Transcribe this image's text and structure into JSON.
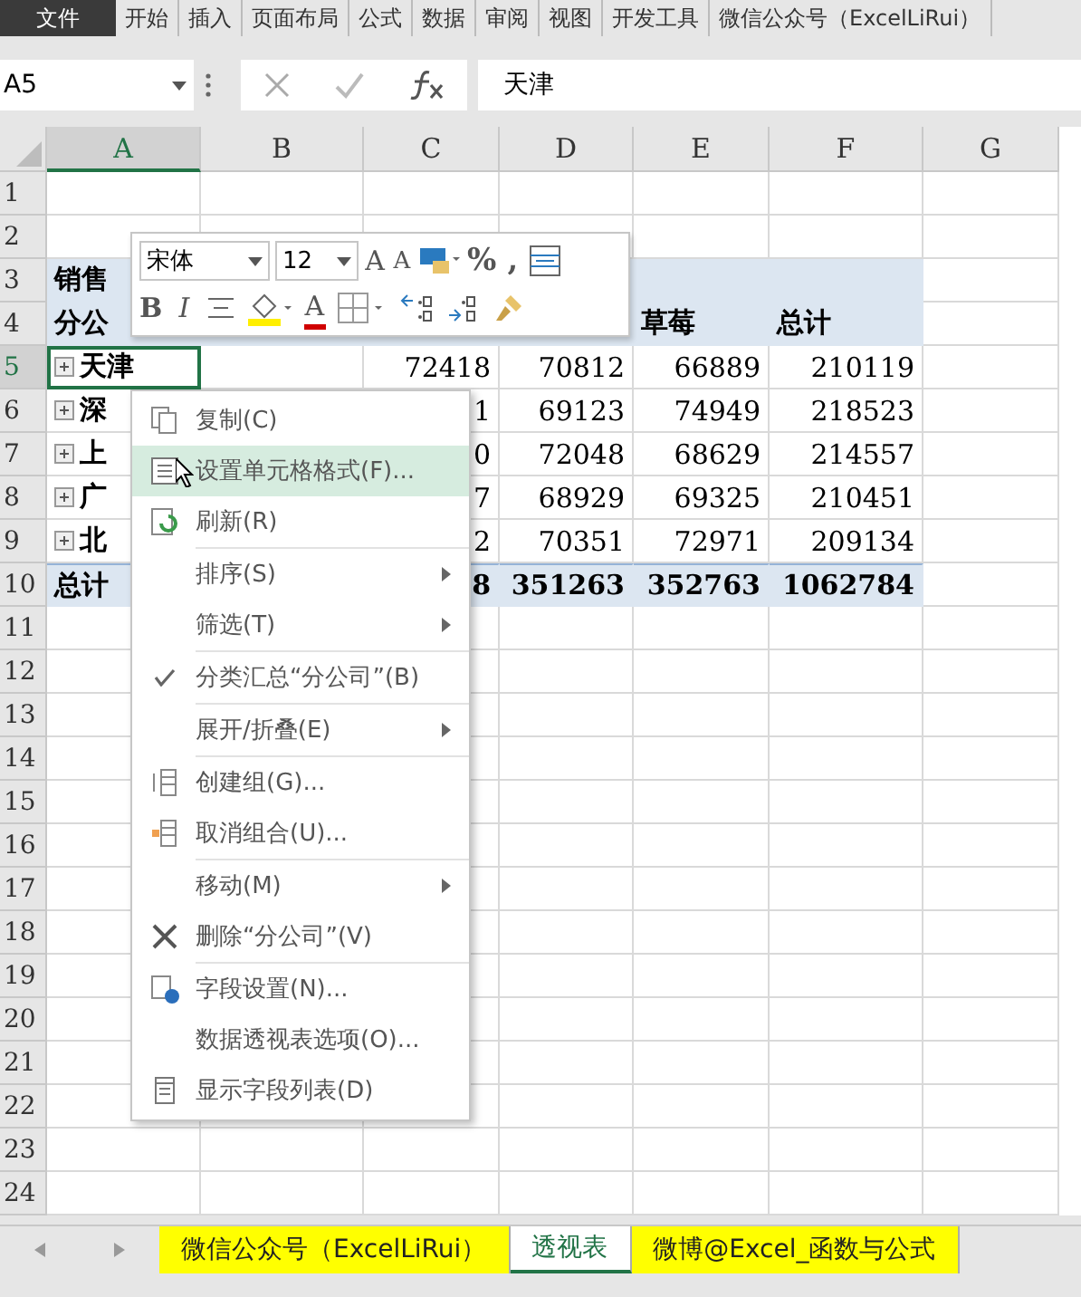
{
  "ribbon_tabs": [
    {
      "label": "文件",
      "selected": true
    },
    {
      "label": "开始",
      "selected": false
    },
    {
      "label": "插入",
      "selected": false
    },
    {
      "label": "页面布局",
      "selected": false
    },
    {
      "label": "公式",
      "selected": false
    },
    {
      "label": "数据",
      "selected": false
    },
    {
      "label": "审阅",
      "selected": false
    },
    {
      "label": "视图",
      "selected": false
    },
    {
      "label": "开发工具",
      "selected": false
    },
    {
      "label": "微信公众号（ExcelLiRui）",
      "selected": false
    }
  ],
  "formula_bar": {
    "name_box": "A5",
    "value": "天津"
  },
  "columns": [
    {
      "label": "A",
      "selected": true
    },
    {
      "label": "B",
      "selected": false
    },
    {
      "label": "C",
      "selected": false
    },
    {
      "label": "D",
      "selected": false
    },
    {
      "label": "E",
      "selected": false
    },
    {
      "label": "F",
      "selected": false
    },
    {
      "label": "G",
      "selected": false
    }
  ],
  "rows": [
    {
      "number": "1",
      "kind": "plain",
      "selected": false
    },
    {
      "number": "2",
      "kind": "plain",
      "selected": false
    },
    {
      "number": "3",
      "kind": "pivot-head",
      "selected": false,
      "col_a": "销售"
    },
    {
      "number": "4",
      "kind": "pivot-head",
      "selected": false,
      "col_a": "分公",
      "col_e": "草莓",
      "col_f": "总计"
    },
    {
      "number": "5",
      "kind": "pivot-item",
      "selected": true,
      "col_a": "天津",
      "col_c": "72418",
      "col_d": "70812",
      "col_e": "66889",
      "col_f": "210119"
    },
    {
      "number": "6",
      "kind": "pivot-item",
      "selected": false,
      "col_a": "深",
      "col_c": "1",
      "col_d": "69123",
      "col_e": "74949",
      "col_f": "218523"
    },
    {
      "number": "7",
      "kind": "pivot-item",
      "selected": false,
      "col_a": "上",
      "col_c": "0",
      "col_d": "72048",
      "col_e": "68629",
      "col_f": "214557"
    },
    {
      "number": "8",
      "kind": "pivot-item",
      "selected": false,
      "col_a": "广",
      "col_c": "7",
      "col_d": "68929",
      "col_e": "69325",
      "col_f": "210451"
    },
    {
      "number": "9",
      "kind": "pivot-item",
      "selected": false,
      "col_a": "北",
      "col_c": "2",
      "col_d": "70351",
      "col_e": "72971",
      "col_f": "209134"
    },
    {
      "number": "10",
      "kind": "pivot-total",
      "selected": false,
      "col_a": "总计",
      "col_c": "8",
      "col_d": "351263",
      "col_e": "352763",
      "col_f": "1062784"
    },
    {
      "number": "11",
      "kind": "plain",
      "selected": false
    },
    {
      "number": "12",
      "kind": "plain",
      "selected": false
    },
    {
      "number": "13",
      "kind": "plain",
      "selected": false
    },
    {
      "number": "14",
      "kind": "plain",
      "selected": false
    },
    {
      "number": "15",
      "kind": "plain",
      "selected": false
    },
    {
      "number": "16",
      "kind": "plain",
      "selected": false
    },
    {
      "number": "17",
      "kind": "plain",
      "selected": false
    },
    {
      "number": "18",
      "kind": "plain",
      "selected": false
    },
    {
      "number": "19",
      "kind": "plain",
      "selected": false
    },
    {
      "number": "20",
      "kind": "plain",
      "selected": false
    },
    {
      "number": "21",
      "kind": "plain",
      "selected": false
    },
    {
      "number": "22",
      "kind": "plain",
      "selected": false
    },
    {
      "number": "23",
      "kind": "plain",
      "selected": false
    },
    {
      "number": "24",
      "kind": "plain",
      "selected": false
    }
  ],
  "mini_toolbar": {
    "font": "宋体",
    "size": "12",
    "row1": [
      {
        "kind": "grow",
        "text": "A"
      },
      {
        "kind": "shrink",
        "text": "A"
      },
      {
        "kind": "accounting"
      },
      {
        "kind": "text",
        "text": "%"
      },
      {
        "kind": "text",
        "text": ","
      },
      {
        "kind": "wrap"
      }
    ],
    "row2": [
      {
        "kind": "bold",
        "text": "B"
      },
      {
        "kind": "italic",
        "text": "I"
      },
      {
        "kind": "align"
      },
      {
        "kind": "fill"
      },
      {
        "kind": "fontcolor",
        "text": "A"
      },
      {
        "kind": "borders"
      },
      {
        "kind": "increase-decimal"
      },
      {
        "kind": "decrease-decimal"
      },
      {
        "kind": "painter"
      }
    ]
  },
  "context_menu": [
    {
      "kind": "item",
      "label": "复制(C)",
      "selected": false
    },
    {
      "kind": "item",
      "label": "设置单元格格式(F)...",
      "selected": true
    },
    {
      "kind": "item",
      "label": "刷新(R)",
      "selected": false
    },
    {
      "kind": "separator"
    },
    {
      "kind": "item",
      "label": "排序(S)",
      "submenu": true,
      "selected": false
    },
    {
      "kind": "item",
      "label": "筛选(T)",
      "submenu": true,
      "selected": false
    },
    {
      "kind": "separator"
    },
    {
      "kind": "item",
      "label": "分类汇总“分公司”(B)",
      "checked": true,
      "selected": false
    },
    {
      "kind": "separator"
    },
    {
      "kind": "item",
      "label": "展开/折叠(E)",
      "submenu": true,
      "selected": false
    },
    {
      "kind": "separator"
    },
    {
      "kind": "item",
      "label": "创建组(G)...",
      "selected": false
    },
    {
      "kind": "item",
      "label": "取消组合(U)...",
      "selected": false
    },
    {
      "kind": "separator"
    },
    {
      "kind": "item",
      "label": "移动(M)",
      "submenu": true,
      "selected": false
    },
    {
      "kind": "item",
      "label": "删除“分公司”(V)",
      "selected": false
    },
    {
      "kind": "separator"
    },
    {
      "kind": "item",
      "label": "字段设置(N)...",
      "selected": false
    },
    {
      "kind": "item",
      "label": "数据透视表选项(O)...",
      "selected": false
    },
    {
      "kind": "item",
      "label": "显示字段列表(D)",
      "selected": false
    }
  ],
  "sheet_tabs": [
    {
      "label": "微信公众号（ExcelLiRui）",
      "selected": false,
      "color": "#ffff00"
    },
    {
      "label": "透视表",
      "selected": true,
      "color": "#ffffff"
    },
    {
      "label": "微博@Excel_函数与公式",
      "selected": false,
      "color": "#ffff00"
    }
  ]
}
